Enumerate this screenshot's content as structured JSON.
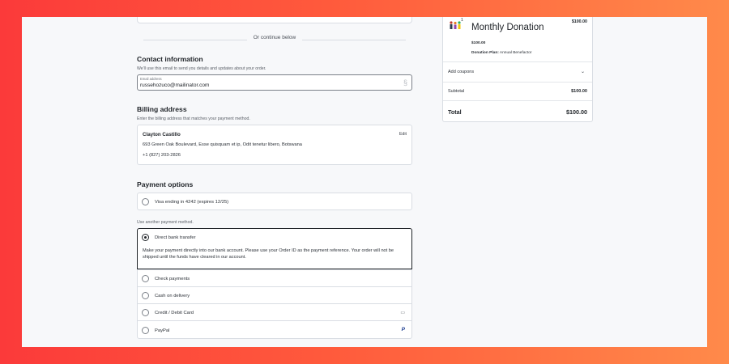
{
  "divider": {
    "text": "Or continue below"
  },
  "contact": {
    "title": "Contact information",
    "subtitle": "We'll use this email to send you details and updates about your order.",
    "email_label": "Email address",
    "email_value": "russehozuco@mailinator.com"
  },
  "billing": {
    "title": "Billing address",
    "subtitle": "Enter the billing address that matches your payment method.",
    "name": "Clayton Castillo",
    "address": "693 Green Oak Boulevard, Esse quisquam et ip, Odit tenetur libero, Botswana",
    "phone": "+1 (827) 203-2826",
    "edit_label": "Edit"
  },
  "payment": {
    "title": "Payment options",
    "saved_card": "Visa ending in 4242 (expires 12/25)",
    "another_label": "Use another payment method.",
    "methods": [
      {
        "label": "Direct bank transfer",
        "selected": true,
        "description": "Make your payment directly into our bank account. Please use your Order ID as the payment reference. Your order will not be shipped until the funds have cleared in our account."
      },
      {
        "label": "Check payments",
        "selected": false
      },
      {
        "label": "Cash on delivery",
        "selected": false
      },
      {
        "label": "Credit / Debit Card",
        "selected": false,
        "icon": "card-icon"
      },
      {
        "label": "PayPal",
        "selected": false,
        "icon": "paypal-icon"
      }
    ]
  },
  "summary": {
    "product": {
      "name": "Monthly Donation",
      "qty": "1",
      "price_top": "$100.00",
      "price": "$100.00",
      "plan_label": "Donation Plan:",
      "plan_value": "Annual Benefactor"
    },
    "coupons_label": "Add coupons",
    "subtotal_label": "Subtotal",
    "subtotal_value": "$100.00",
    "total_label": "Total",
    "total_value": "$100.00"
  }
}
